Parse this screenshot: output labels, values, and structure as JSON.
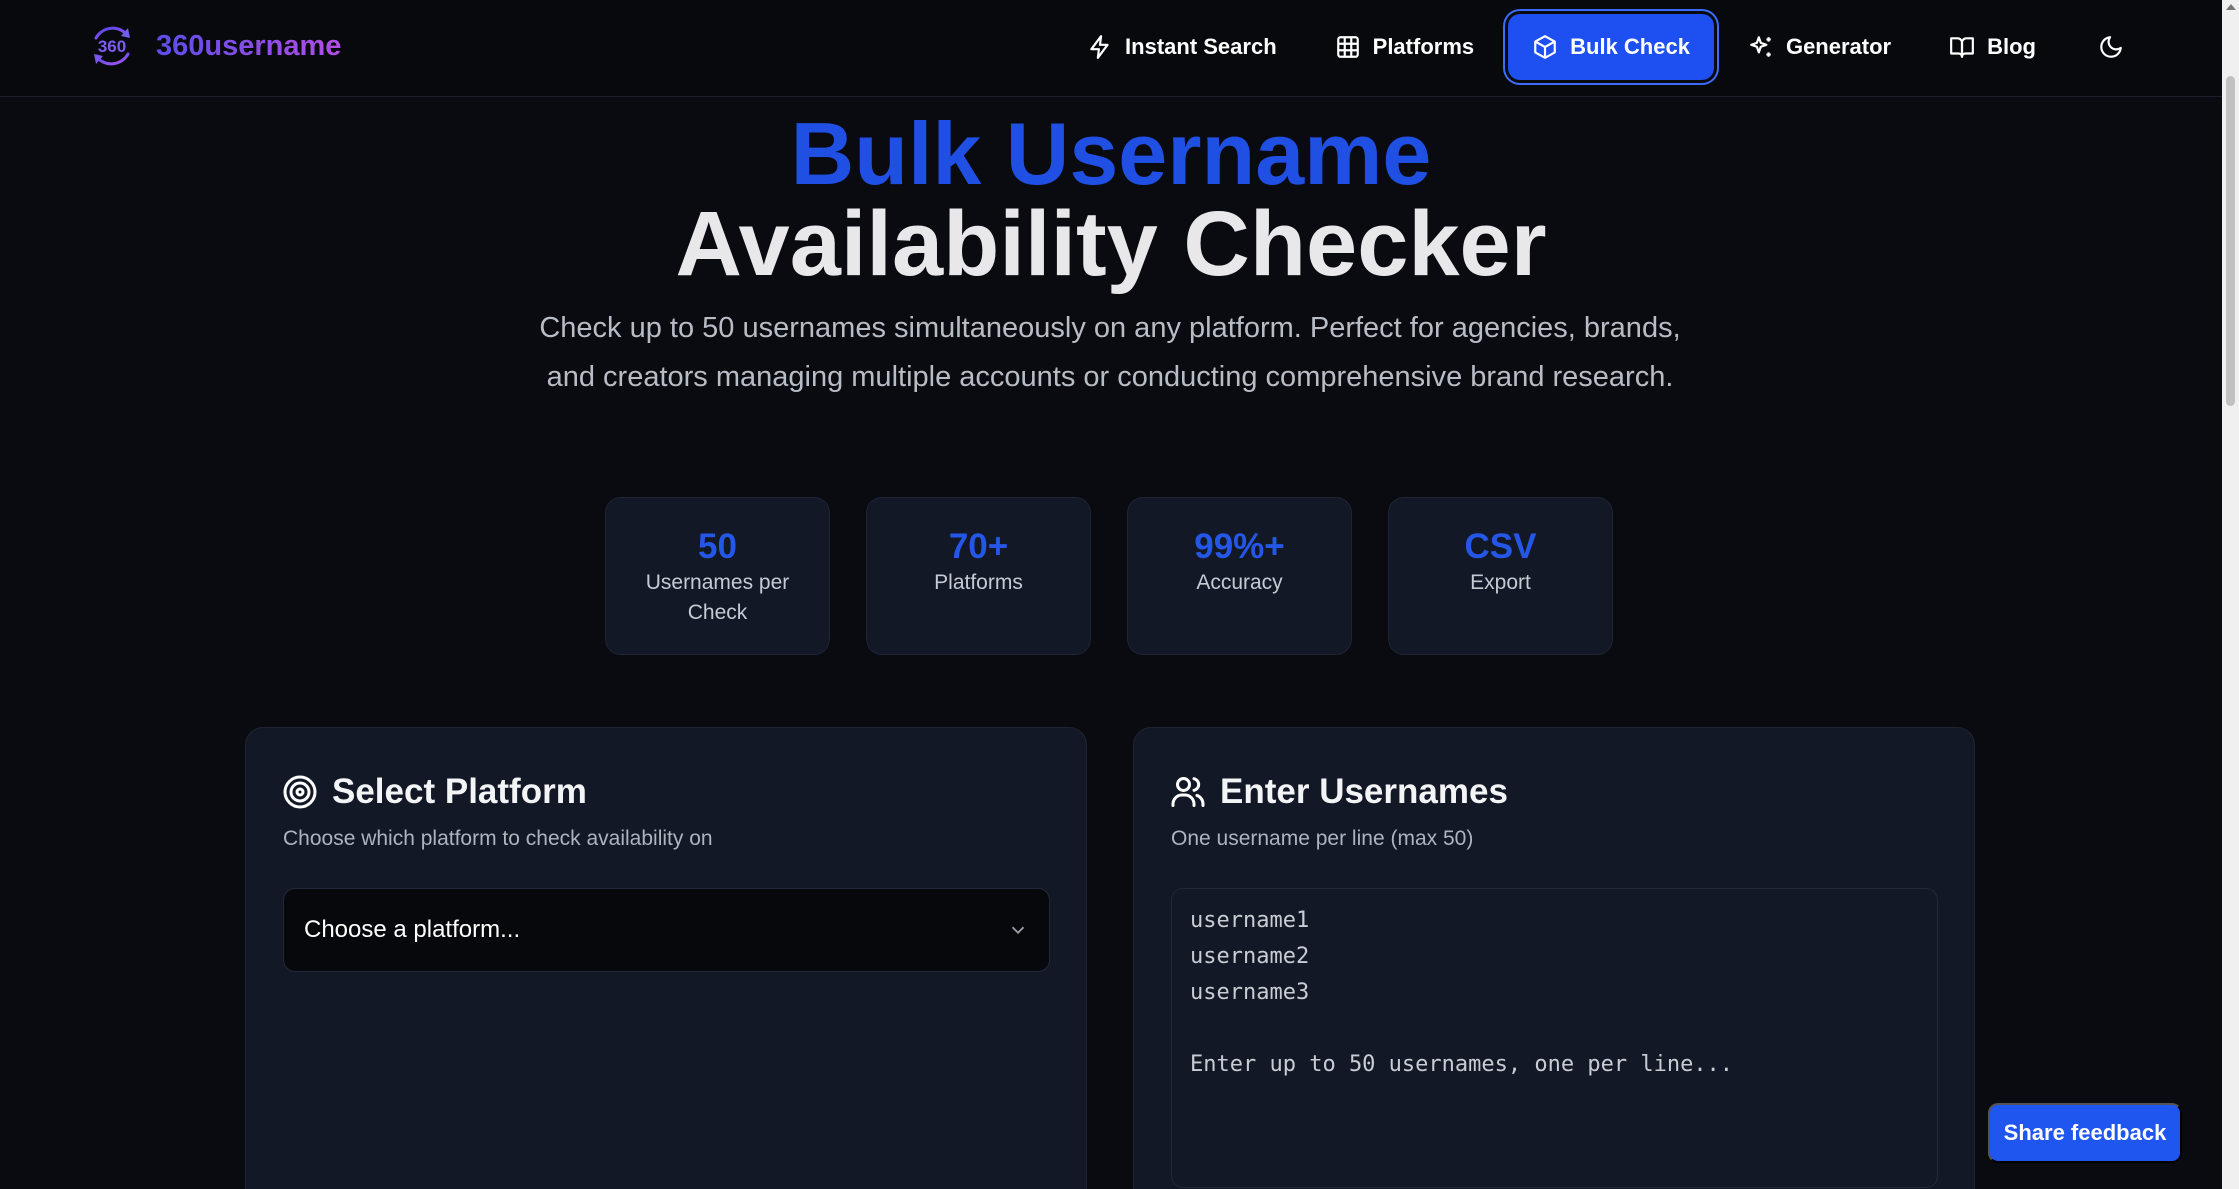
{
  "brand": {
    "name": "360username",
    "logo_icon": "360-cycle-logo-icon"
  },
  "nav": {
    "items": [
      {
        "label": "Instant Search",
        "icon": "bolt-icon"
      },
      {
        "label": "Platforms",
        "icon": "grid-icon"
      },
      {
        "label": "Bulk Check",
        "icon": "box-icon",
        "active": true
      },
      {
        "label": "Generator",
        "icon": "sparkles-icon"
      },
      {
        "label": "Blog",
        "icon": "book-icon"
      }
    ],
    "theme_toggle_icon": "moon-icon"
  },
  "hero": {
    "title_line1": "Bulk Username",
    "title_line2": "Availability Checker",
    "subtitle": "Check up to 50 usernames simultaneously on any platform. Perfect for agencies, brands, and creators managing multiple accounts or conducting comprehensive brand research."
  },
  "stats": [
    {
      "value": "50",
      "label": "Usernames per Check"
    },
    {
      "value": "70+",
      "label": "Platforms"
    },
    {
      "value": "99%+",
      "label": "Accuracy"
    },
    {
      "value": "CSV",
      "label": "Export"
    }
  ],
  "platform_card": {
    "title": "Select Platform",
    "subtitle": "Choose which platform to check availability on",
    "select_value": "Choose a platform...",
    "icon": "target-icon"
  },
  "usernames_card": {
    "title": "Enter Usernames",
    "subtitle": "One username per line (max 50)",
    "placeholder": "username1\nusername2\nusername3\n\nEnter up to 50 usernames, one per line...",
    "icon": "users-icon"
  },
  "feedback": {
    "label": "Share feedback"
  },
  "colors": {
    "accent": "#1e4ff0",
    "background": "#0a0b10",
    "card": "#131826"
  }
}
